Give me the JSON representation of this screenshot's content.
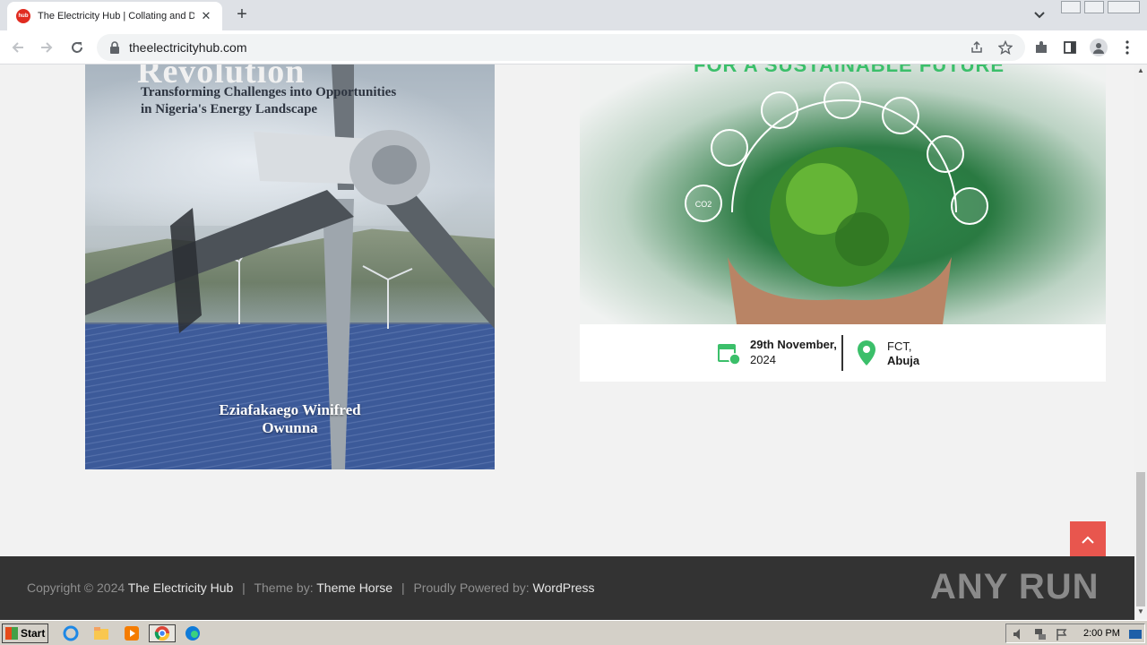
{
  "browser": {
    "tab_title": "The Electricity Hub | Collating and Di",
    "favicon_text": "hub",
    "url": "theelectricityhub.com"
  },
  "page": {
    "book": {
      "title_partial": "Revolution",
      "subtitle_line1": "Transforming Challenges into Opportunities",
      "subtitle_line2": "in Nigeria's Energy Landscape",
      "author_line1": "Eziafakaego Winifred",
      "author_line2": "Owunna"
    },
    "flyer": {
      "headline_partial": "FOR A SUSTAINABLE FUTURE",
      "date_bold": "29th November,",
      "date_year": "2024",
      "location_line1": "FCT,",
      "location_line2": "Abuja",
      "icon_label_co2": "CO2"
    },
    "footer": {
      "copyright": "Copyright © 2024",
      "site_link": "The Electricity Hub",
      "theme_prefix": "Theme by:",
      "theme_link": "Theme Horse",
      "powered_prefix": "Proudly Powered by:",
      "powered_link": "WordPress",
      "separator": "|",
      "watermark": "ANY RUN"
    }
  },
  "taskbar": {
    "start_label": "Start",
    "clock": "2:00 PM"
  },
  "colors": {
    "accent_red": "#e8564e",
    "flyer_green": "#3bbf6a",
    "footer_bg": "#333333"
  }
}
